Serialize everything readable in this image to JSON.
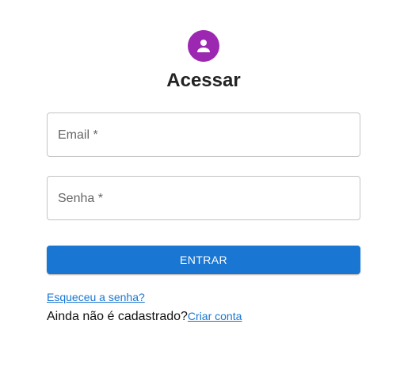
{
  "header": {
    "avatar_icon": "person-icon",
    "avatar_color": "#9c27b0",
    "title": "Acessar"
  },
  "form": {
    "email": {
      "label": "Email *",
      "value": ""
    },
    "senha": {
      "label": "Senha *",
      "value": ""
    },
    "submit_label": "ENTRAR",
    "submit_color": "#1976d2"
  },
  "links": {
    "forgot_password": "Esqueceu a senha?",
    "signup_prompt": "Ainda não é cadastrado?",
    "signup_link": "Criar conta",
    "link_color": "#1976d2"
  }
}
